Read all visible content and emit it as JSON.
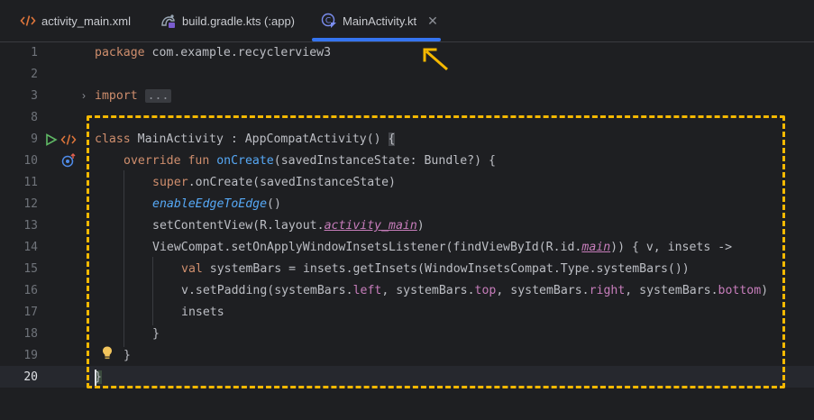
{
  "tabs": [
    {
      "label": "activity_main.xml",
      "icon": "xml-code-icon",
      "active": false
    },
    {
      "label": "build.gradle.kts (:app)",
      "icon": "gradle-icon",
      "active": false
    },
    {
      "label": "MainActivity.kt",
      "icon": "kotlin-class-icon",
      "active": true
    }
  ],
  "annotation_color": "#f5b800",
  "accent": "#3574f0",
  "line_numbers": [
    "1",
    "2",
    "3",
    "8",
    "9",
    "10",
    "11",
    "12",
    "13",
    "14",
    "15",
    "16",
    "17",
    "18",
    "19",
    "20"
  ],
  "code": {
    "l1_kw": "package",
    "l1_rest": " com.example.recyclerview3",
    "l3_kw": "import",
    "l3_fold": "...",
    "l9_kw": "class",
    "l9_rest": " MainActivity : AppCompatActivity() ",
    "l9_brace": "{",
    "l10_kw": "override fun",
    "l10_fn": "onCreate",
    "l10_rest": "(savedInstanceState: Bundle?) {",
    "l11_kw": "super",
    "l11_rest": ".onCreate(savedInstanceState)",
    "l12_it": "enableEdgeToEdge",
    "l12_rest": "()",
    "l13_a": "setContentView(R.layout.",
    "l13_res": "activity_main",
    "l13_b": ")",
    "l14_a": "ViewCompat.setOnApplyWindowInsetsListener(findViewById(R.id.",
    "l14_res": "main",
    "l14_b": ")) { v, insets ->",
    "l15_kw": "val",
    "l15_rest": " systemBars = insets.getInsets(WindowInsetsCompat.Type.systemBars())",
    "l16_a": "v.setPadding(systemBars.",
    "l16_p1": "left",
    "l16_b": ", systemBars.",
    "l16_p2": "top",
    "l16_c": ", systemBars.",
    "l16_p3": "right",
    "l16_d": ", systemBars.",
    "l16_p4": "bottom",
    "l16_e": ")",
    "l17": "insets",
    "l18": "}",
    "l19": "}",
    "l20": "}"
  }
}
